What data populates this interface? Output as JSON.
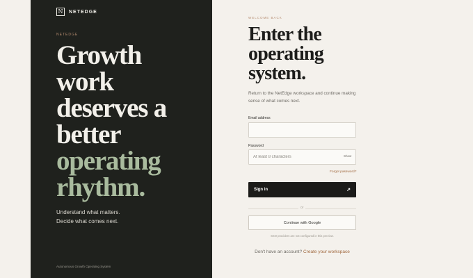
{
  "brand": {
    "mark": "N",
    "name": "NETEDGE"
  },
  "left": {
    "eyebrow": "NETEDGE",
    "headline": [
      "Growth",
      "work",
      "deserves a",
      "better"
    ],
    "headline_accent": [
      "operating",
      "rhythm."
    ],
    "tagline": [
      "Understand what matters.",
      "Decide what comes next."
    ],
    "footer": "Autonomous Growth Operating System"
  },
  "form": {
    "eyebrow": "WELCOME BACK",
    "title": [
      "Enter the",
      "operating",
      "system."
    ],
    "subtitle": "Return to the NetEdge workspace and continue making sense of what comes next.",
    "email": {
      "label": "Email address",
      "value": "",
      "placeholder": ""
    },
    "password": {
      "label": "Password",
      "value": "",
      "placeholder": "At least 8 characters",
      "toggle": "Show"
    },
    "forgot": "Forgot password?",
    "signin_label": "Sign in",
    "signin_icon": "arrow-up-right-icon",
    "divider": "or",
    "google_label": "Continue with Google",
    "sso_note": "SSO providers are not configured in this preview.",
    "signup_prompt": "Don't have an account?",
    "signup_link": "Create your workspace"
  },
  "colors": {
    "panel_dark": "#1f211d",
    "background": "#f4f1ec",
    "accent_green": "#a9bb9e",
    "accent_copper": "#a0683e",
    "button_dark": "#1b1b19"
  }
}
